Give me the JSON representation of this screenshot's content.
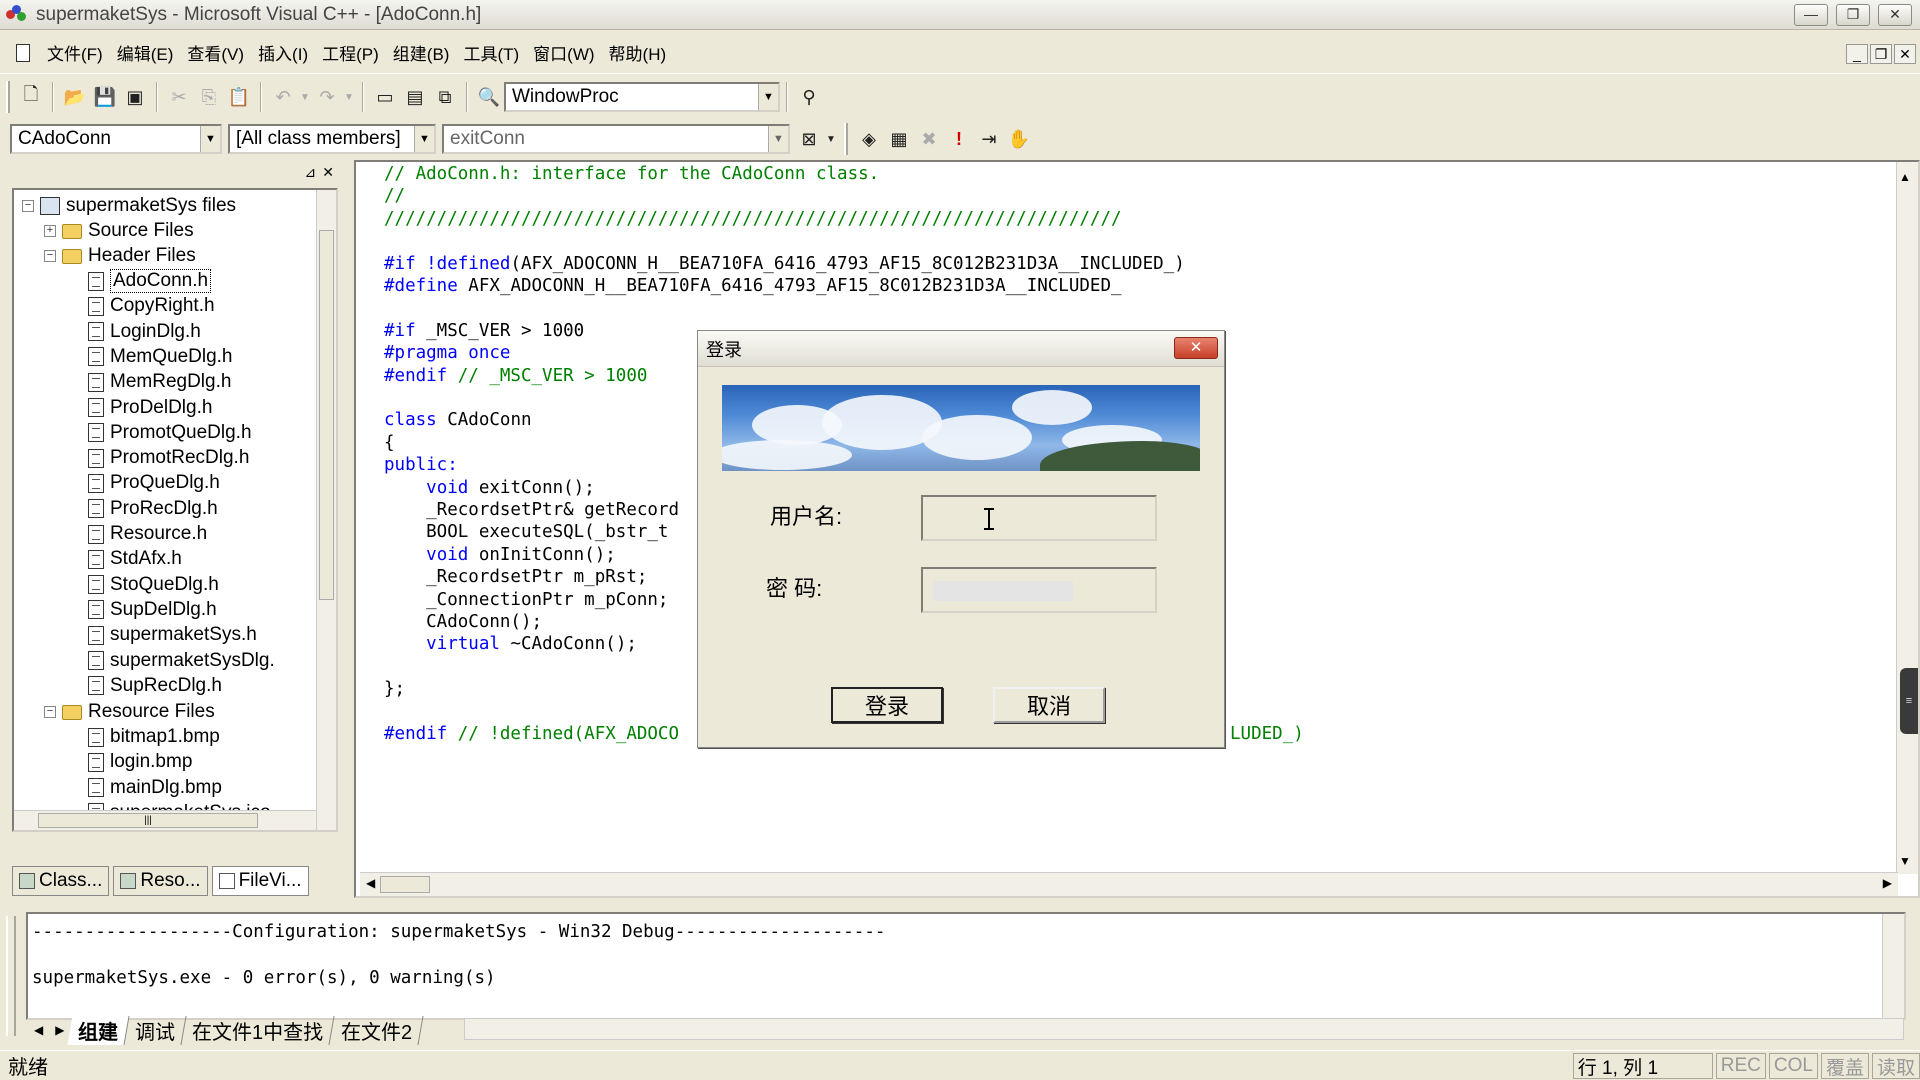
{
  "window": {
    "title": "supermaketSys - Microsoft Visual C++ - [AdoConn.h]",
    "min": "—",
    "max": "❐",
    "close": "✕"
  },
  "menu": [
    "文件(F)",
    "编辑(E)",
    "查看(V)",
    "插入(I)",
    "工程(P)",
    "组建(B)",
    "工具(T)",
    "窗口(W)",
    "帮助(H)"
  ],
  "mdi": {
    "min": "_",
    "restore": "❐",
    "close": "✕"
  },
  "toolbar1": {
    "combo_value": "WindowProc"
  },
  "toolbar2": {
    "class_combo": "CAdoConn",
    "filter_combo": "[All class members]",
    "member_combo": "exitConn"
  },
  "tree": {
    "root": "supermaketSys files",
    "source_folder": "Source Files",
    "header_folder": "Header Files",
    "header_files": [
      "AdoConn.h",
      "CopyRight.h",
      "LoginDlg.h",
      "MemQueDlg.h",
      "MemRegDlg.h",
      "ProDelDlg.h",
      "PromotQueDlg.h",
      "PromotRecDlg.h",
      "ProQueDlg.h",
      "ProRecDlg.h",
      "Resource.h",
      "StdAfx.h",
      "StoQueDlg.h",
      "SupDelDlg.h",
      "supermaketSys.h",
      "supermaketSysDlg.",
      "SupRecDlg.h"
    ],
    "resource_folder": "Resource Files",
    "resource_files": [
      "bitmap1.bmp",
      "login.bmp",
      "mainDlg.bmp",
      "supermaketSys.ico"
    ],
    "selected": "AdoConn.h"
  },
  "panel_tabs": [
    "Class...",
    "Reso...",
    "FileVi..."
  ],
  "code": [
    {
      "t": "// AdoConn.h: interface for the CAdoConn class.",
      "c": "comment"
    },
    {
      "t": "//",
      "c": "comment"
    },
    {
      "t": "//////////////////////////////////////////////////////////////////////",
      "c": "comment"
    },
    {
      "t": "",
      "c": "txt"
    },
    {
      "k": "#if !defined",
      "r": "(AFX_ADOCONN_H__BEA710FA_6416_4793_AF15_8C012B231D3A__INCLUDED_)"
    },
    {
      "k": "#define",
      "r": " AFX_ADOCONN_H__BEA710FA_6416_4793_AF15_8C012B231D3A__INCLUDED_"
    },
    {
      "t": "",
      "c": "txt"
    },
    {
      "k": "#if",
      "r": " _MSC_VER > 1000"
    },
    {
      "t": "#pragma once",
      "c": "kw"
    },
    {
      "k": "#endif",
      "r": " // _MSC_VER > 1000",
      "rc": "comment"
    },
    {
      "t": "",
      "c": "txt"
    },
    {
      "k": "class",
      "r": " CAdoConn"
    },
    {
      "t": "{",
      "c": "txt"
    },
    {
      "t": "public:",
      "c": "kw"
    },
    {
      "p": "    ",
      "k": "void",
      "r": " exitConn();"
    },
    {
      "t": "    _RecordsetPtr& getRecord",
      "c": "txt"
    },
    {
      "t": "    BOOL executeSQL(_bstr_t",
      "c": "txt"
    },
    {
      "p": "    ",
      "k": "void",
      "r": " onInitConn();"
    },
    {
      "t": "    _RecordsetPtr m_pRst;",
      "c": "txt"
    },
    {
      "t": "    _ConnectionPtr m_pConn;",
      "c": "txt"
    },
    {
      "t": "    CAdoConn();",
      "c": "txt"
    },
    {
      "p": "    ",
      "k": "virtual",
      "r": " ~CAdoConn();"
    },
    {
      "t": "",
      "c": "txt"
    },
    {
      "t": "};",
      "c": "txt"
    },
    {
      "t": "",
      "c": "txt"
    },
    {
      "k": "#endif",
      "r": " // !defined(AFX_ADOCO",
      "rc": "comment",
      "tail": "LUDED_)"
    }
  ],
  "output": {
    "line1": "-------------------Configuration: supermaketSys - Win32 Debug--------------------",
    "line2": "supermaketSys.exe - 0 error(s), 0 warning(s)",
    "tabs": [
      "组建",
      "调试",
      "在文件1中查找",
      "在文件2"
    ]
  },
  "status": {
    "ready": "就绪",
    "position": "行 1, 列 1",
    "rec": "REC",
    "col": "COL",
    "ovr": "覆盖",
    "read": "读取"
  },
  "dialog": {
    "title": "登录",
    "close": "✕",
    "user_label": "用户名:",
    "pass_label": "密 码:",
    "user_value": "",
    "login_button": "登录",
    "cancel_button": "取消"
  }
}
